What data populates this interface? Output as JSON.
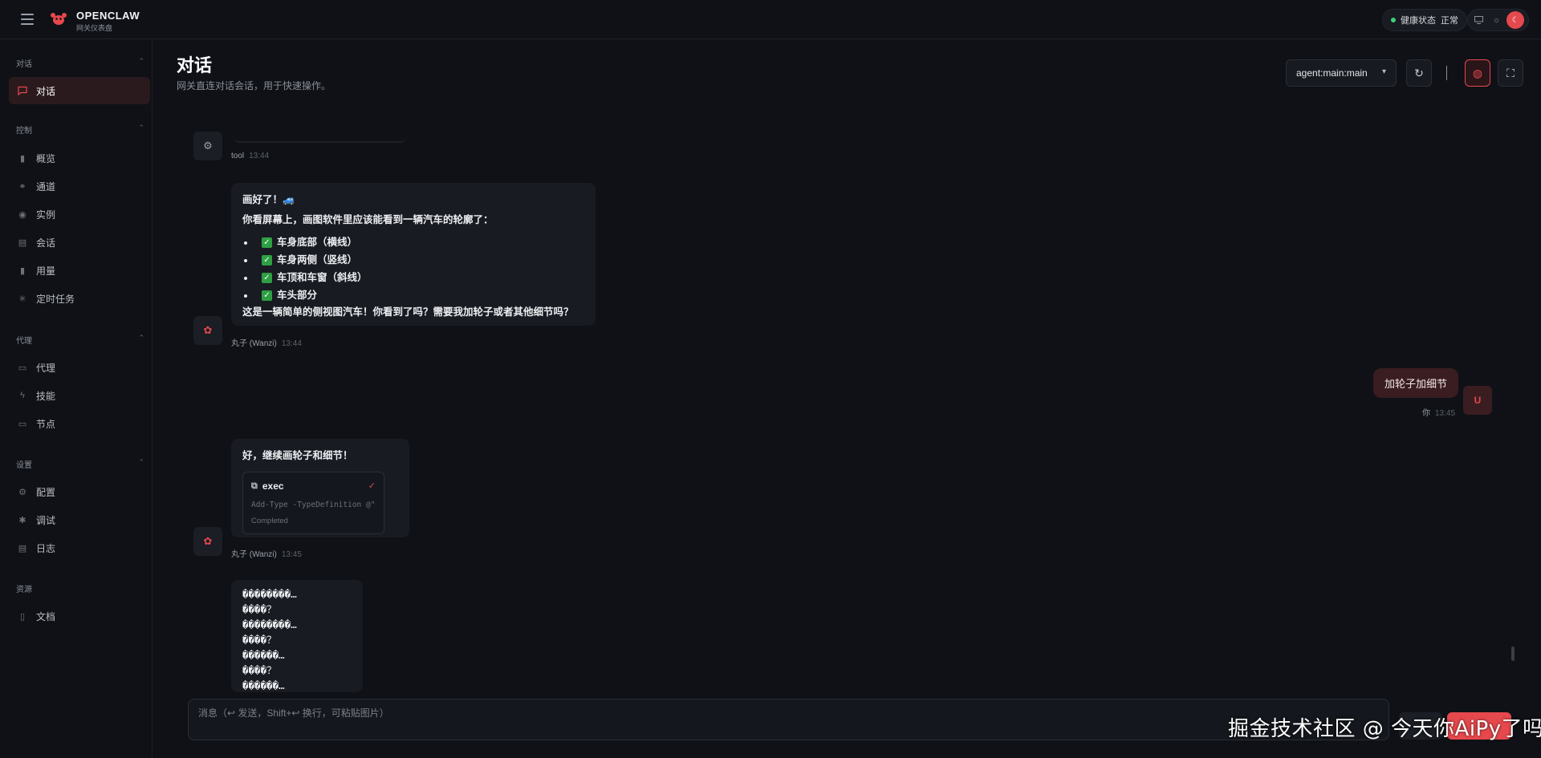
{
  "topbar": {
    "app_name": "OPENCLAW",
    "app_subtitle": "网关仪表盘",
    "health_label": "健康状态",
    "health_value": "正常"
  },
  "sidebar": {
    "groups": [
      {
        "title": "对话",
        "items": [
          {
            "label": "对话",
            "icon": "chat-icon"
          }
        ]
      },
      {
        "title": "控制",
        "items": [
          {
            "label": "概览",
            "icon": "bar-chart-icon"
          },
          {
            "label": "通道",
            "icon": "link-icon"
          },
          {
            "label": "实例",
            "icon": "radio-icon"
          },
          {
            "label": "会话",
            "icon": "document-icon"
          },
          {
            "label": "用量",
            "icon": "bar-chart-icon"
          },
          {
            "label": "定时任务",
            "icon": "loader-icon"
          }
        ]
      },
      {
        "title": "代理",
        "items": [
          {
            "label": "代理",
            "icon": "folder-icon"
          },
          {
            "label": "技能",
            "icon": "zap-icon"
          },
          {
            "label": "节点",
            "icon": "monitor-icon"
          }
        ]
      },
      {
        "title": "设置",
        "items": [
          {
            "label": "配置",
            "icon": "gear-icon"
          },
          {
            "label": "调试",
            "icon": "bug-icon"
          },
          {
            "label": "日志",
            "icon": "log-icon"
          }
        ]
      },
      {
        "title": "资源",
        "items": [
          {
            "label": "文档",
            "icon": "book-icon"
          }
        ]
      }
    ]
  },
  "header": {
    "title": "对话",
    "subtitle": "网关直连对话会话，用于快速操作。",
    "agent_select": "agent:main:main"
  },
  "chat": {
    "tool_msg": {
      "who": "tool",
      "time": "13:44"
    },
    "msg1": {
      "title": "画好了！🚙",
      "intro": "你看屏幕上，画图软件里应该能看到一辆汽车的轮廓了：",
      "items": [
        "车身底部（横线）",
        "车身两侧（竖线）",
        "车顶和车窗（斜线）",
        "车头部分"
      ],
      "outro": "这是一辆简单的侧视图汽车！你看到了吗？需要我加轮子或者其他细节吗？",
      "who": "丸子 (Wanzi)",
      "time": "13:44"
    },
    "user_msg": {
      "text": "加轮子加细节",
      "who": "你",
      "time": "13:45",
      "avatar": "U"
    },
    "msg2": {
      "text": "好，继续画轮子和细节！",
      "tool_name": "exec",
      "tool_cmd": "Add-Type -TypeDefinition @\"",
      "tool_status": "Completed",
      "who": "丸子 (Wanzi)",
      "time": "13:45"
    },
    "msg3": {
      "lines": [
        "��������…",
        "����？",
        "��������…",
        "����？",
        "������…",
        "����？",
        "������…"
      ]
    }
  },
  "composer": {
    "placeholder": "消息（↩ 发送，Shift+↩ 换行，可粘贴图片）"
  },
  "watermark": "掘金技术社区 @ 今天你AiPy了吗",
  "colors": {
    "accent": "#e5484d",
    "bg": "#0f1116",
    "bubble": "#181b22",
    "user_bubble": "#3a1d21"
  }
}
